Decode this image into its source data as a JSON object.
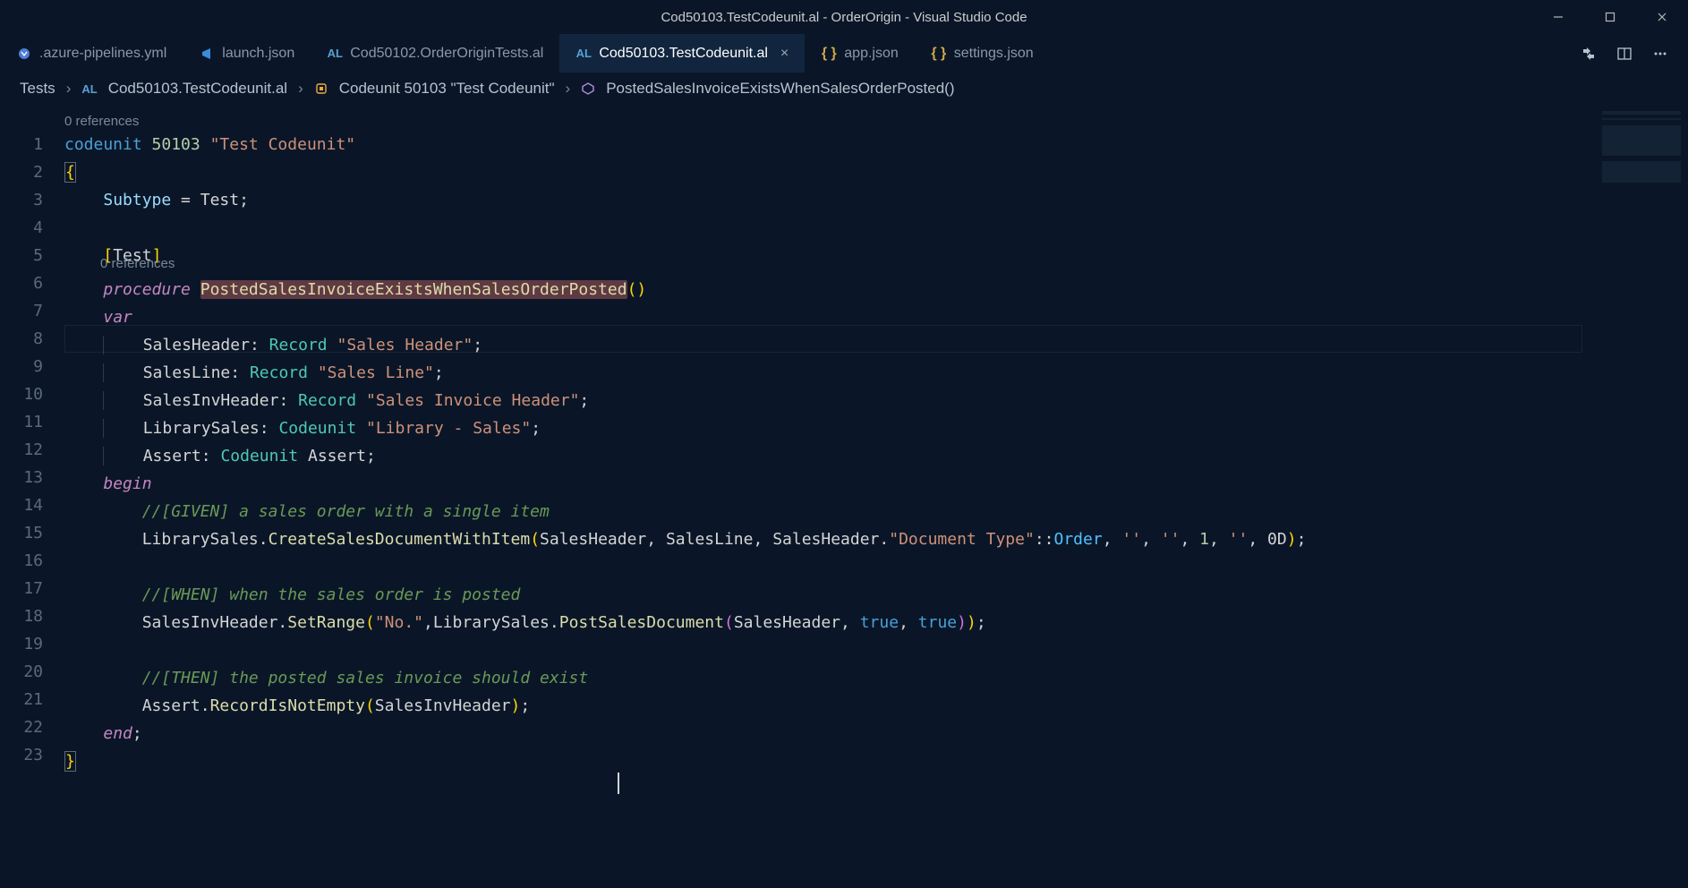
{
  "window": {
    "title": "Cod50103.TestCodeunit.al - OrderOrigin - Visual Studio Code"
  },
  "tabs": [
    {
      "label": ".azure-pipelines.yml",
      "icon": "yaml",
      "active": false
    },
    {
      "label": "launch.json",
      "icon": "json",
      "active": false
    },
    {
      "label": "Cod50102.OrderOriginTests.al",
      "icon": "al",
      "active": false
    },
    {
      "label": "Cod50103.TestCodeunit.al",
      "icon": "al",
      "active": true,
      "close": "×"
    },
    {
      "label": "app.json",
      "icon": "json-braces",
      "active": false
    },
    {
      "label": "settings.json",
      "icon": "json-braces",
      "active": false
    }
  ],
  "breadcrumbs": {
    "root": "Tests",
    "file_prefix": "AL",
    "file": "Cod50103.TestCodeunit.al",
    "symbol1": "Codeunit 50103 \"Test Codeunit\"",
    "symbol2": "PostedSalesInvoiceExistsWhenSalesOrderPosted()"
  },
  "codelens": {
    "ref1": "0 references",
    "ref2": "0 references"
  },
  "code": {
    "l1": {
      "kw": "codeunit",
      "num": "50103",
      "str": "\"Test Codeunit\""
    },
    "l2": "{",
    "l3": {
      "prop": "Subtype",
      "eq": " = ",
      "val": "Test",
      "semi": ";"
    },
    "l5": {
      "br": "[",
      "attr": "Test",
      "br2": "]"
    },
    "l6": {
      "kw": "procedure",
      "name": "PostedSalesInvoiceExistsWhenSalesOrderPosted",
      "paren": "()"
    },
    "l7": "var",
    "l8": {
      "id": "SalesHeader",
      "col": ": ",
      "type": "Record",
      "str": "\"Sales Header\"",
      "semi": ";"
    },
    "l9": {
      "id": "SalesLine",
      "col": ": ",
      "type": "Record",
      "str": "\"Sales Line\"",
      "semi": ";"
    },
    "l10": {
      "id": "SalesInvHeader",
      "col": ": ",
      "type": "Record",
      "str": "\"Sales Invoice Header\"",
      "semi": ";"
    },
    "l11": {
      "id": "LibrarySales",
      "col": ": ",
      "type": "Codeunit",
      "str": "\"Library - Sales\"",
      "semi": ";"
    },
    "l12": {
      "id": "Assert",
      "col": ": ",
      "type": "Codeunit",
      "val": "Assert",
      "semi": ";"
    },
    "l13": "begin",
    "l14": "//[GIVEN] a sales order with a single item",
    "l15": {
      "pre": "LibrarySales.",
      "call": "CreateSalesDocumentWithItem",
      "a_sh": "SalesHeader",
      "a_sl": "SalesLine",
      "a_sh2": "SalesHeader",
      "fld": "\"Document Type\"",
      "dcol": "::",
      "enum": "Order",
      "s1": "''",
      "s2": "''",
      "n1": "1",
      "s3": "''",
      "n0d": "0D"
    },
    "l17": "//[WHEN] when the sales order is posted",
    "l18": {
      "pre": "SalesInvHeader.",
      "call": "SetRange",
      "fld": "\"No.\"",
      "pre2": "LibrarySales.",
      "call2": "PostSalesDocument",
      "a_sh": "SalesHeader",
      "t1": "true",
      "t2": "true"
    },
    "l20": "//[THEN] the posted sales invoice should exist",
    "l21": {
      "pre": "Assert.",
      "call": "RecordIsNotEmpty",
      "arg": "SalesInvHeader"
    },
    "l22": {
      "kw": "end",
      "semi": ";"
    },
    "l23": "}"
  },
  "line_numbers": [
    "1",
    "2",
    "3",
    "4",
    "5",
    "6",
    "7",
    "8",
    "9",
    "10",
    "11",
    "12",
    "13",
    "14",
    "15",
    "16",
    "17",
    "18",
    "19",
    "20",
    "21",
    "22",
    "23"
  ]
}
